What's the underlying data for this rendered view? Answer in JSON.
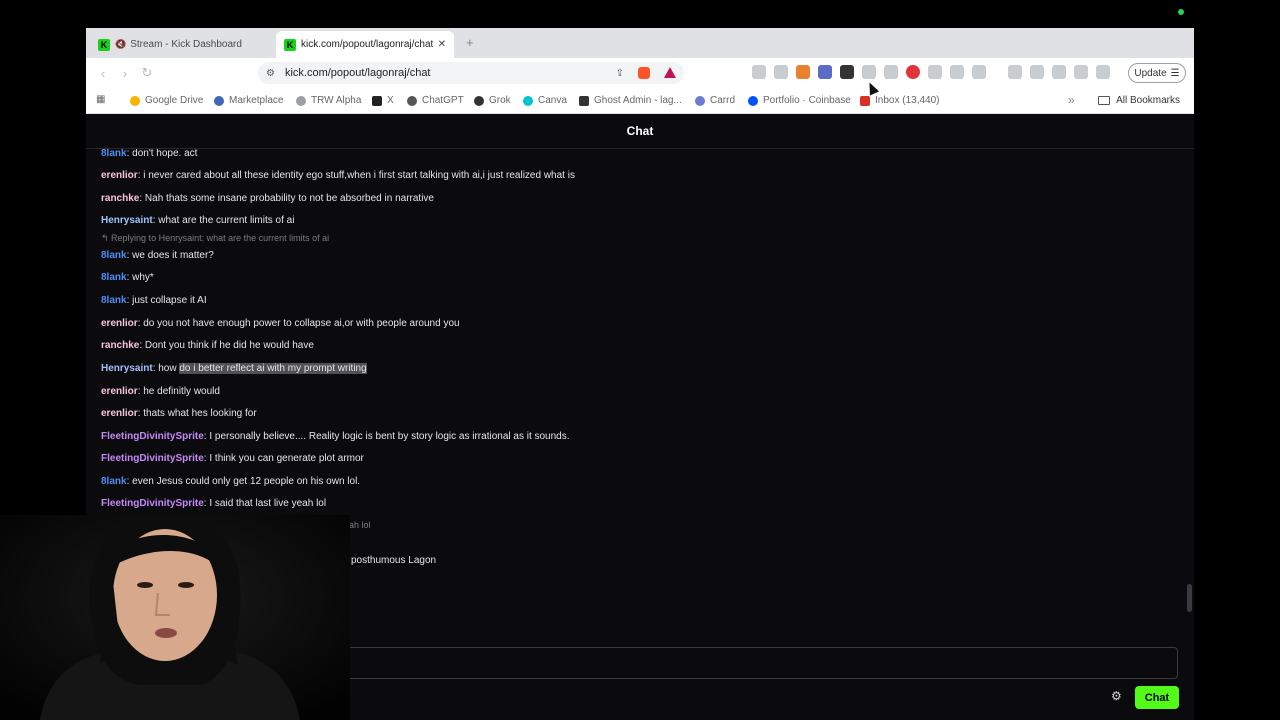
{
  "browser": {
    "tabs": [
      {
        "title": "Stream - Kick Dashboard",
        "favicon": "K",
        "active": false
      },
      {
        "title": "kick.com/popout/lagonraj/chat",
        "favicon": "K",
        "active": true
      }
    ],
    "address": "kick.com/popout/lagonraj/chat",
    "update_label": "Update",
    "bookmarks": [
      "Google Drive",
      "Marketplace",
      "TRW Alpha",
      "X",
      "ChatGPT",
      "Grok",
      "Canva",
      "Ghost Admin - lag...",
      "Carrd",
      "Portfolio · Coinbase",
      "Inbox (13,440)"
    ],
    "all_bookmarks_label": "All Bookmarks"
  },
  "chat": {
    "header": "Chat",
    "submit_label": "Chat",
    "colors": {
      "accent": "#53fc18",
      "user_blue": "#4e8df7",
      "user_pink": "#f5c5d9",
      "user_purple": "#c58af9",
      "user_lightblue": "#9ec1ff"
    },
    "reply_context": "Replying to Henrysaint: what are the current limits of ai",
    "messages": [
      {
        "user": "8lank",
        "text": ": don't hope. act",
        "color": "#4e8df7"
      },
      {
        "user": "erenlior",
        "text": ": i never cared about all these identity ego stuff,when i first start talking with ai,i just realized what is",
        "color": "#f5c5d9"
      },
      {
        "user": "ranchke",
        "text": ": Nah thats some insane probability to not be absorbed in narrative",
        "color": "#f5c5d9"
      },
      {
        "user": "Henrysaint",
        "text": ": what are the current limits of ai",
        "color": "#9ec1ff"
      },
      {
        "user": "8lank",
        "text": ": we does it matter?",
        "color": "#4e8df7"
      },
      {
        "user": "8lank",
        "text": ": why*",
        "color": "#4e8df7"
      },
      {
        "user": "8lank",
        "text": ": just collapse it AI",
        "color": "#4e8df7"
      },
      {
        "user": "erenlior",
        "text": ": do you not have enough power to collapse ai,or with people around you",
        "color": "#f5c5d9"
      },
      {
        "user": "ranchke",
        "text": ": Dont you think if he did he would have",
        "color": "#f5c5d9"
      },
      {
        "user": "Henrysaint",
        "text": ": how ",
        "highlight": "do i better reflect ai with my prompt writing",
        "color": "#9ec1ff"
      },
      {
        "user": "erenlior",
        "text": ": he definitly would",
        "color": "#f5c5d9"
      },
      {
        "user": "erenlior",
        "text": ": thats what hes looking for",
        "color": "#f5c5d9"
      },
      {
        "user": "FleetingDivinitySprite",
        "text": ": I personally believe.... Reality logic is bent by story logic as irrational as it sounds.",
        "color": "#c58af9"
      },
      {
        "user": "FleetingDivinitySprite",
        "text": ": I think you can generate plot armor",
        "color": "#c58af9"
      },
      {
        "user": "8lank",
        "text": ": even Jesus could only get 12 people on his own lol.",
        "color": "#4e8df7"
      },
      {
        "user": "FleetingDivinitySprite",
        "text": ": I said that last live yeah lol",
        "color": "#c58af9"
      }
    ],
    "partial_lines": [
      "eah lol",
      "posthumous Lagon"
    ]
  }
}
